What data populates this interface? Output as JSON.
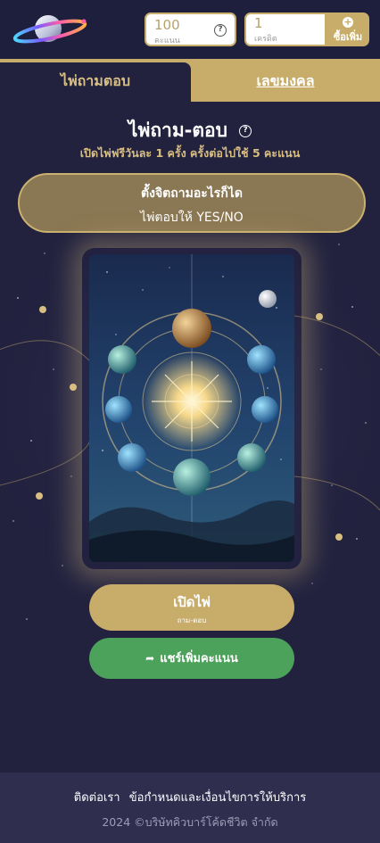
{
  "header": {
    "score": {
      "value": "100",
      "unit": "คะแนน"
    },
    "credit": {
      "value": "1",
      "unit": "เครดิต"
    },
    "buy_label": "ซื้อเพิ่ม"
  },
  "tabs": [
    {
      "label": "ไพ่ถามตอบ",
      "active": true
    },
    {
      "label": "เลขมงคล",
      "active": false
    }
  ],
  "main": {
    "title": "ไพ่ถาม-ตอบ",
    "subtitle": "เปิดไพ่ฟรีวันละ 1 ครั้ง ครั้งต่อไปใช้ 5 คะแนน",
    "banner_line1": "ตั้งจิตถามอะไรก็ได",
    "banner_line2": "ไพ่ตอบให้ YES/NO",
    "open_button": {
      "label": "เปิดไพ่",
      "sub": "ถาม-ตอบ"
    },
    "share_button": {
      "label": "แชร์เพิ่มคะแนน"
    }
  },
  "footer": {
    "contact": "ติดต่อเรา",
    "terms": "ข้อกำหนดและเงื่อนไขการให้บริการ",
    "copyright": "2024 ©บริษัทคิวบาร์โค้ดชีวิต จำกัด"
  },
  "colors": {
    "background": "#22223f",
    "gold": "#c8ad6a",
    "share_green": "#4ca25a",
    "footer": "#2f2e4e"
  },
  "icons": [
    "saturn-logo-icon",
    "help-circle-icon",
    "plus-circle-icon",
    "share-arrow-icon"
  ]
}
